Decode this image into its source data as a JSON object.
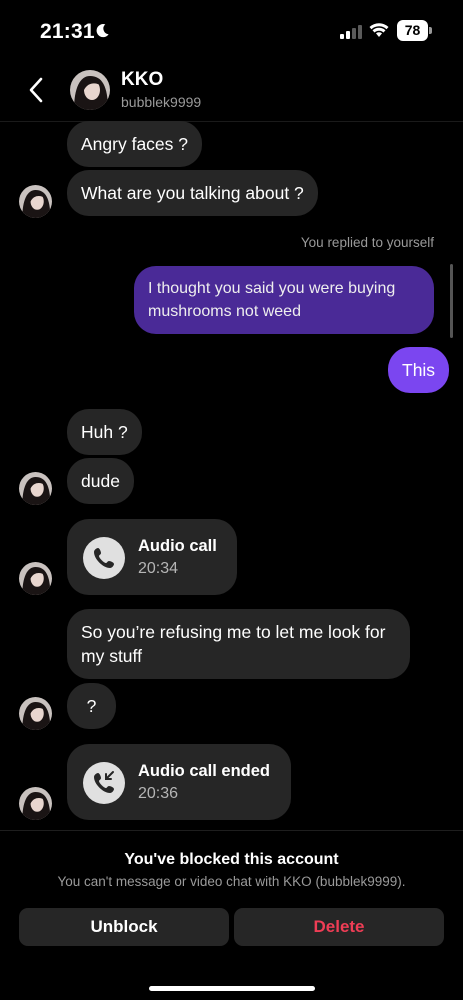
{
  "status_bar": {
    "time": "21:31",
    "battery": "78"
  },
  "header": {
    "name": "KKO",
    "username": "bubblek9999"
  },
  "messages": {
    "m1": "Angry faces ?",
    "m2": "What are you talking about ?",
    "reply_note": "You replied to yourself",
    "m3": "I thought you said you were buying mushrooms not weed",
    "m4": "This",
    "m5": "Huh ?",
    "m6": "dude",
    "call1": {
      "title": "Audio call",
      "time": "20:34"
    },
    "m7": "So you’re refusing me to let me look for my stuff",
    "m8": "?",
    "call2": {
      "title": "Audio call ended",
      "time": "20:36"
    }
  },
  "footer": {
    "title": "You've blocked this account",
    "subtitle": "You can't message or video chat with KKO (bubblek9999).",
    "unblock_label": "Unblock",
    "delete_label": "Delete"
  },
  "colors": {
    "outgoing_bubble": "#4a2a97",
    "highlight_bubble": "#7b46f0",
    "incoming_bubble": "#262626",
    "delete": "#ef3d55"
  },
  "icons": [
    "moon-icon",
    "signal-icon",
    "wifi-icon",
    "battery-icon",
    "back-chevron-icon",
    "phone-icon",
    "call-ended-icon"
  ]
}
